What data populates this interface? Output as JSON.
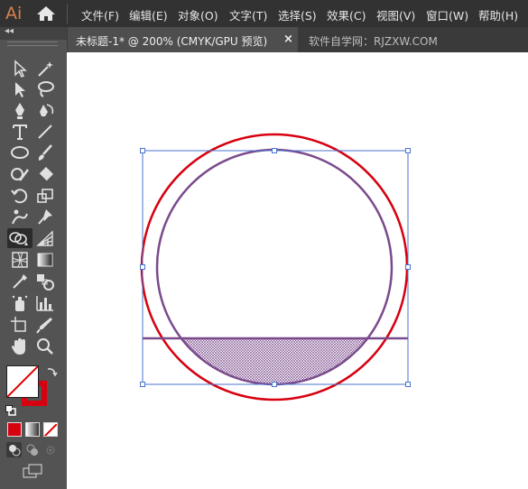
{
  "app": {
    "logo": "Ai"
  },
  "menu": {
    "items": [
      "文件(F)",
      "编辑(E)",
      "对象(O)",
      "文字(T)",
      "选择(S)",
      "效果(C)",
      "视图(V)",
      "窗口(W)",
      "帮助(H)"
    ]
  },
  "tabs": {
    "active": {
      "label": "未标题-1* @ 200% (CMYK/GPU 预览)",
      "close": "×"
    },
    "second": {
      "label": "软件自学网：RJZXW.COM"
    }
  },
  "toolbar": {
    "collapse": "◂◂",
    "tools": [
      "selection-tool",
      "magic-wand-tool",
      "direct-selection-tool",
      "lasso-tool",
      "pen-tool",
      "curvature-tool",
      "type-tool",
      "line-segment-tool",
      "ellipse-tool",
      "paintbrush-tool",
      "shaper-tool",
      "eraser-tool",
      "rotate-tool",
      "scale-tool",
      "puppet-warp-tool",
      "pin-tool",
      "shape-builder-tool",
      "perspective-grid-tool",
      "mesh-tool",
      "gradient-tool",
      "eyedropper-tool",
      "blend-tool",
      "symbol-sprayer-tool",
      "column-graph-tool",
      "artboard-tool",
      "slice-tool",
      "hand-tool",
      "zoom-tool"
    ],
    "selected_tool": "shape-builder-tool",
    "fill": "none",
    "stroke_color": "#d7000f",
    "color_modes": [
      "color",
      "gradient",
      "none"
    ],
    "draw_modes": [
      "draw-normal",
      "draw-behind",
      "draw-inside"
    ]
  },
  "artwork": {
    "outer_circle_color": "#d7000f",
    "inner_circle_color": "#7a4a8c",
    "selection_color": "#4a73d0",
    "hatch_fill": "#7a4a8c"
  }
}
